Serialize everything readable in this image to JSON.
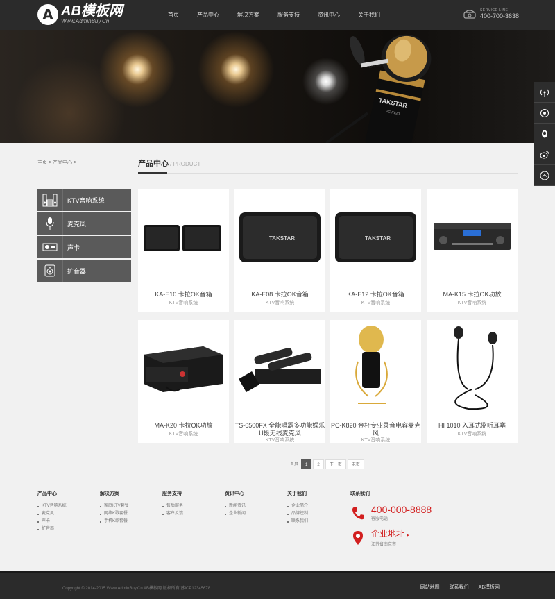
{
  "brand": {
    "logo_letter": "A",
    "logo_main": "AB模板网",
    "logo_sub": "Www.AdminBuy.Cn"
  },
  "nav": [
    "首页",
    "产品中心",
    "解决方案",
    "服务支持",
    "资讯中心",
    "关于我们"
  ],
  "hotline": {
    "label": "SERVICE LINE",
    "number": "400-700-3638"
  },
  "breadcrumb": {
    "home": "主页",
    "sep1": " > ",
    "current": "产品中心",
    "sep2": " > "
  },
  "section": {
    "title": "产品中心",
    "sub": " / PRODUCT"
  },
  "categories": [
    {
      "label": "KTV音响系统",
      "icon": "speaker-cabinet-icon"
    },
    {
      "label": "麦克风",
      "icon": "microphone-icon"
    },
    {
      "label": "声卡",
      "icon": "sound-card-icon"
    },
    {
      "label": "扩音器",
      "icon": "loudspeaker-icon"
    }
  ],
  "products": [
    {
      "name": "KA-E10 卡拉OK音箱",
      "category": "KTV音响系统"
    },
    {
      "name": "KA-E08 卡拉OK音箱",
      "category": "KTV音响系统"
    },
    {
      "name": "KA-E12 卡拉OK音箱",
      "category": "KTV音响系统"
    },
    {
      "name": "MA-K15 卡拉OK功放",
      "category": "KTV音响系统"
    },
    {
      "name": "MA-K20 卡拉OK功放",
      "category": "KTV音响系统"
    },
    {
      "name": "TS-6500FX 全能唱霸多功能娱乐U段无线麦克风",
      "category": "KTV音响系统"
    },
    {
      "name": "PC-K820 金杯专业录音电容麦克风",
      "category": "KTV音响系统"
    },
    {
      "name": "HI 1010 入耳式监听耳塞",
      "category": "KTV音响系统"
    }
  ],
  "pager": {
    "total": "首页",
    "p1": "1",
    "p2": "2",
    "next": "下一页",
    "last": "末页"
  },
  "footer_cols": [
    {
      "title": "产品中心",
      "items": [
        "KTV音响系统",
        "麦克风",
        "声卡",
        "扩音器"
      ]
    },
    {
      "title": "解决方案",
      "items": [
        "家庭KTV套餐",
        "网络K歌套餐",
        "手机K歌套餐"
      ]
    },
    {
      "title": "服务支持",
      "items": [
        "售后服务",
        "客户反馈"
      ]
    },
    {
      "title": "资讯中心",
      "items": [
        "新闻资讯",
        "企业新闻"
      ]
    },
    {
      "title": "关于我们",
      "items": [
        "企业简介",
        "品牌控制",
        "联系我们"
      ]
    }
  ],
  "contact": {
    "title": "联系我们",
    "phone": "400-000-8888",
    "phone_sub": "客服电话",
    "addr": "企业地址",
    "addr_sub": "江苏省南京市"
  },
  "copyright": "Copyright © 2014-2015 Www.AdminBuy.Cn AB模板网 版权所有 苏ICP12345678",
  "footer_links": [
    "网站地图",
    "联系我们",
    "AB模板网"
  ],
  "colors": {
    "accent": "#d21f1f",
    "header": "#2b2b2b"
  }
}
